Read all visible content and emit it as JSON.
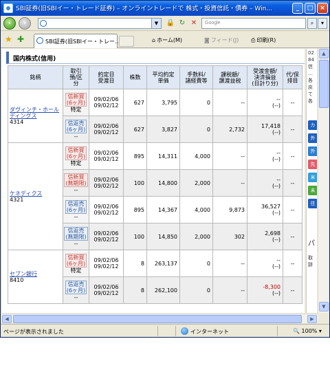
{
  "window": {
    "title": "SBI証券(旧SBIイー・トレード証券) – オンライントレードで 株式・投資信託・債券 – Win..."
  },
  "address": {
    "search_placeholder": "Google"
  },
  "tab": {
    "label": "SBI証券(旧SBIイー・トレー..."
  },
  "commands": {
    "home": "ホーム(M)",
    "feed": "フィード(J)",
    "print": "印刷(R)"
  },
  "section": {
    "title": "国内株式(信用)"
  },
  "table": {
    "headers": {
      "name": "銘柄",
      "kind": "取引\n預/区\n分",
      "dates": "約定日\n受渡日",
      "qty": "株数",
      "price": "平均約定\n単価",
      "fee": "手数料/\n諸経費等",
      "tax": "課税額/\n譲渡益税",
      "pl": "受渡金額/\n決済損益\n(日計り分)",
      "last": "代/保\n排目"
    },
    "groups": [
      {
        "name": "ダヴィンチ・ホールディングス",
        "code": "4314",
        "rows": [
          {
            "kind": "信新買",
            "period": "(6ヶ月)",
            "sub": "特定",
            "date1": "09/02/06",
            "date2": "09/02/12",
            "qty": "627",
            "price": "3,795",
            "fee": "0",
            "tax": "--",
            "pl1": "--",
            "pl2": "(--)",
            "last": "--"
          },
          {
            "kind": "信返売",
            "period": "(6ヶ月)",
            "sub": "--",
            "date1": "09/02/06",
            "date2": "09/02/12",
            "qty": "627",
            "price": "3,827",
            "fee": "0",
            "tax": "2,732",
            "pl1": "17,418",
            "pl2": "(--)",
            "last": "--"
          }
        ]
      },
      {
        "name": "ケネディクス",
        "code": "4321",
        "rows": [
          {
            "kind": "信新買",
            "period": "(6ヶ月)",
            "sub": "特定",
            "date1": "09/02/06",
            "date2": "09/02/12",
            "qty": "895",
            "price": "14,311",
            "fee": "4,000",
            "tax": "--",
            "pl1": "--",
            "pl2": "(--)",
            "last": "--"
          },
          {
            "kind": "信新買",
            "period": "(無期限)",
            "sub": "--",
            "date1": "09/02/06",
            "date2": "09/02/12",
            "qty": "100",
            "price": "14,800",
            "fee": "2,000",
            "tax": "--",
            "pl1": "--",
            "pl2": "(--)",
            "last": "--"
          },
          {
            "kind": "信返売",
            "period": "(6ヶ月)",
            "sub": "--",
            "date1": "09/02/06",
            "date2": "09/02/12",
            "qty": "895",
            "price": "14,367",
            "fee": "4,000",
            "tax": "9,873",
            "pl1": "36,527",
            "pl2": "(--)",
            "last": "--"
          },
          {
            "kind": "信返売",
            "period": "(無期限)",
            "sub": "--",
            "date1": "09/02/06",
            "date2": "09/02/12",
            "qty": "100",
            "price": "14,850",
            "fee": "2,000",
            "tax": "302",
            "pl1": "2,698",
            "pl2": "(--)",
            "last": "--"
          }
        ]
      },
      {
        "name": "セブン銀行",
        "code": "8410",
        "rows": [
          {
            "kind": "信新買",
            "period": "(6ヶ月)",
            "sub": "特定",
            "date1": "09/02/06",
            "date2": "09/02/12",
            "qty": "8",
            "price": "263,137",
            "fee": "0",
            "tax": "--",
            "pl1": "--",
            "pl2": "(--)",
            "last": "--"
          },
          {
            "kind": "信返売",
            "period": "(6ヶ月)",
            "sub": "--",
            "date1": "09/02/06",
            "date2": "09/02/12",
            "qty": "8",
            "price": "262,100",
            "fee": "0",
            "tax": "--",
            "pl1": "-8,300",
            "pl2": "(--)",
            "last": "--"
          }
        ]
      }
    ]
  },
  "side_panel": {
    "top_lines": [
      "02",
      "84",
      "信",
      "…",
      "各",
      "戻",
      "て",
      "各"
    ],
    "buttons": [
      "カ",
      "外",
      "外",
      "先",
      "米",
      "未",
      "往"
    ],
    "mid_lines": [
      "パ",
      "取",
      "辞"
    ]
  },
  "status": {
    "message": "ページが表示されました",
    "zone": "インターネット",
    "zoom": "100%"
  },
  "colors": {
    "titlebar": "#0a5fe0",
    "header_bg": "#dfe8f4",
    "link": "#2348a8",
    "buy_badge": "#c0392b",
    "sell_badge": "#2a5597"
  }
}
